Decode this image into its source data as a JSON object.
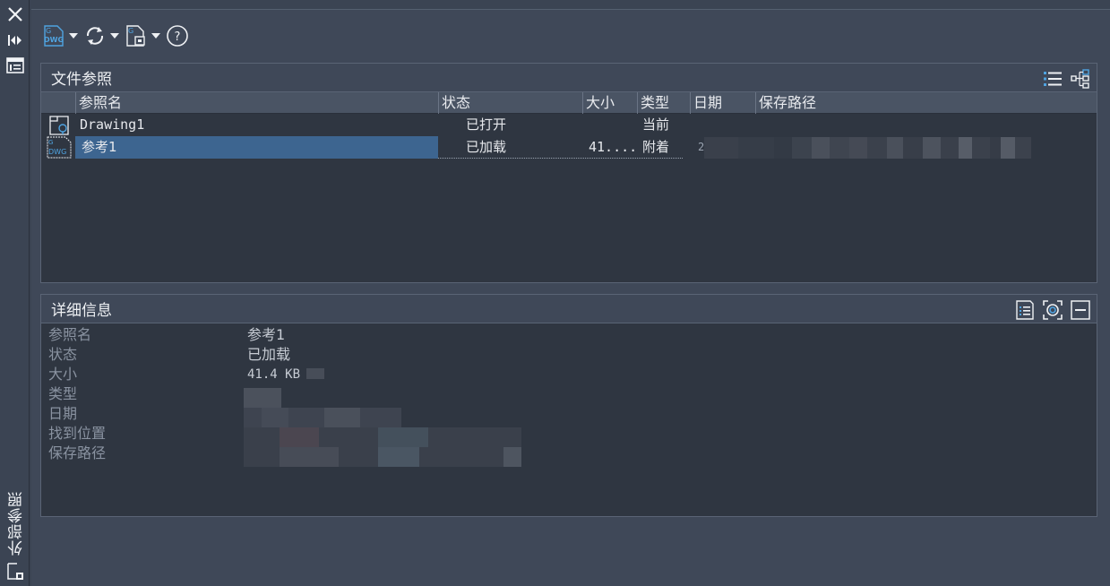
{
  "palette": {
    "title": "外部参照",
    "close_icon": "close-icon",
    "collapse_icon": "collapse-arrows-icon",
    "properties_icon": "properties-icon"
  },
  "toolbar": {
    "attach_icon": "attach-dwg-icon",
    "refresh_icon": "refresh-icon",
    "change_path_icon": "change-path-icon",
    "help_label": "?"
  },
  "file_refs": {
    "title": "文件参照",
    "columns": [
      "参照名",
      "状态",
      "大小",
      "类型",
      "日期",
      "保存路径"
    ],
    "rows": [
      {
        "name": "Drawing1",
        "status": "已打开",
        "size": "",
        "type": "当前",
        "date": "",
        "path": ""
      },
      {
        "name": "参考1",
        "status": "已加载",
        "size": "41....",
        "type": "附着",
        "date": "2025",
        "path": ""
      }
    ],
    "icon_dwg_label": "DWG",
    "icon_g_label": "G"
  },
  "details": {
    "title": "详细信息",
    "rows": [
      {
        "label": "参照名",
        "value": "参考1"
      },
      {
        "label": "状态",
        "value": "已加载"
      },
      {
        "label": "大小",
        "value": "41.4 KB"
      },
      {
        "label": "类型",
        "value": ""
      },
      {
        "label": "日期",
        "value": ""
      },
      {
        "label": "找到位置",
        "value": ""
      },
      {
        "label": "保存路径",
        "value": ""
      }
    ]
  },
  "colors": {
    "background": "#3b4453",
    "panel": "#2f3641",
    "selection": "#3d6590",
    "accent": "#4fa3e0"
  }
}
